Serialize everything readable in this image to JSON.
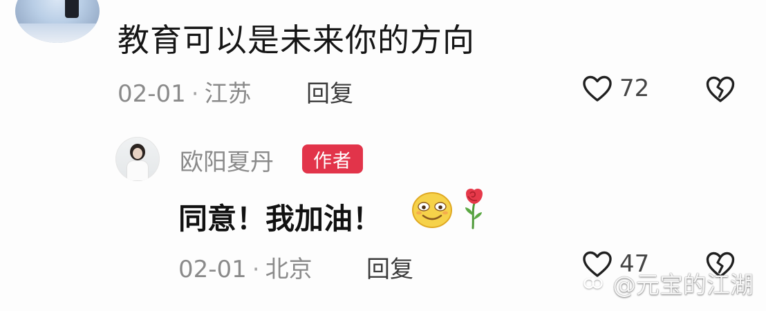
{
  "comment": {
    "text": "教育可以是未来你的方向",
    "meta": {
      "date": "02-01",
      "separator": "·",
      "location": "江苏"
    },
    "reply_label": "回复",
    "likes": "72"
  },
  "reply": {
    "author_name": "欧阳夏丹",
    "author_badge": "作者",
    "text": "同意！我加油！",
    "meta": {
      "date": "02-01",
      "separator": "·",
      "location": "北京"
    },
    "reply_label": "回复",
    "likes": "47"
  },
  "watermark": {
    "text": "@元宝的江湖"
  },
  "icons": {
    "like": "heart-outline-icon",
    "dislike": "broken-heart-icon",
    "smile_emoji": "smile-emoji-icon",
    "rose_emoji": "rose-emoji-icon",
    "watermark_logo": "app-logo-icon"
  },
  "colors": {
    "background": "#fdfdfd",
    "primary_text": "#161616",
    "secondary_text": "#8a8a8a",
    "badge_red": "#e2344a"
  }
}
